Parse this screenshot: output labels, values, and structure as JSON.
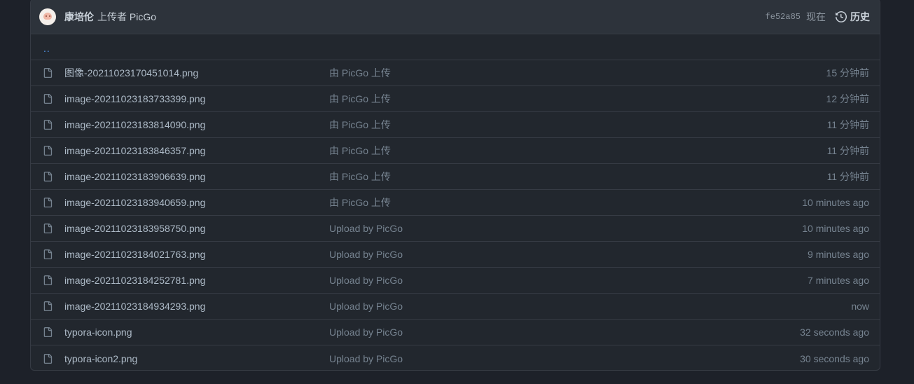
{
  "commit": {
    "author": "康培伦",
    "message": "上传者 PicGo",
    "sha": "fe52a85",
    "time": "现在",
    "history_label": "历史"
  },
  "parent_dir": "..",
  "files": [
    {
      "name": "图像-20211023170451014.png",
      "commit": "由 PicGo 上传",
      "age": "15 分钟前"
    },
    {
      "name": "image-20211023183733399.png",
      "commit": "由 PicGo 上传",
      "age": "12 分钟前"
    },
    {
      "name": "image-20211023183814090.png",
      "commit": "由 PicGo 上传",
      "age": "11 分钟前"
    },
    {
      "name": "image-20211023183846357.png",
      "commit": "由 PicGo 上传",
      "age": "11 分钟前"
    },
    {
      "name": "image-20211023183906639.png",
      "commit": "由 PicGo 上传",
      "age": "11 分钟前"
    },
    {
      "name": "image-20211023183940659.png",
      "commit": "由 PicGo 上传",
      "age": "10 minutes ago"
    },
    {
      "name": "image-20211023183958750.png",
      "commit": "Upload by PicGo",
      "age": "10 minutes ago"
    },
    {
      "name": "image-20211023184021763.png",
      "commit": "Upload by PicGo",
      "age": "9 minutes ago"
    },
    {
      "name": "image-20211023184252781.png",
      "commit": "Upload by PicGo",
      "age": "7 minutes ago"
    },
    {
      "name": "image-20211023184934293.png",
      "commit": "Upload by PicGo",
      "age": "now"
    },
    {
      "name": "typora-icon.png",
      "commit": "Upload by PicGo",
      "age": "32 seconds ago"
    },
    {
      "name": "typora-icon2.png",
      "commit": "Upload by PicGo",
      "age": "30 seconds ago"
    }
  ],
  "icons": {
    "file": "file-icon",
    "history": "history-icon",
    "avatar": "avatar"
  },
  "colors": {
    "background": "#1d2129",
    "panel": "#22272e",
    "header": "#2d333b",
    "border": "#363b44",
    "link": "#539bf5",
    "muted": "#768390"
  }
}
